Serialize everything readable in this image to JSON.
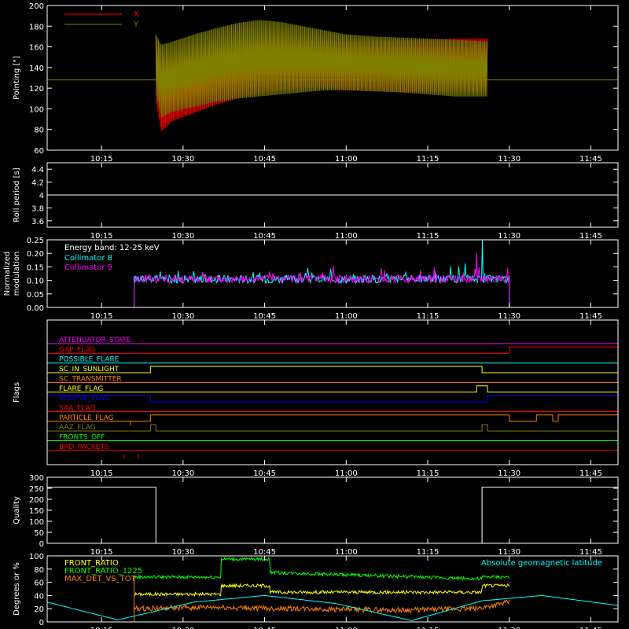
{
  "chart_data": [
    {
      "type": "line",
      "panel": "pointing",
      "ylabel": "Pointing [\"]",
      "ylim": [
        60,
        200
      ],
      "yticks": [
        60,
        80,
        100,
        120,
        140,
        160,
        180,
        200
      ],
      "xlim": [
        "10:05",
        "11:50"
      ],
      "xticks": [
        "10:15",
        "10:30",
        "10:45",
        "11:00",
        "11:15",
        "11:30",
        "11:45"
      ],
      "baseline": 128,
      "data_start": "10:25",
      "data_end": "11:26",
      "series": [
        {
          "name": "X",
          "color": "#ff0000",
          "time": [
            "10:25",
            "10:26",
            "10:28",
            "10:32",
            "10:36",
            "10:40",
            "10:44",
            "10:48",
            "10:52",
            "10:56",
            "11:00",
            "11:05",
            "11:10",
            "11:15",
            "11:20",
            "11:26"
          ],
          "upper": [
            170,
            155,
            150,
            152,
            158,
            162,
            165,
            167,
            166,
            165,
            165,
            166,
            166,
            167,
            168,
            168
          ],
          "lower": [
            108,
            78,
            88,
            96,
            104,
            110,
            115,
            118,
            120,
            120,
            118,
            117,
            116,
            116,
            116,
            116
          ]
        },
        {
          "name": "Y",
          "color": "#808000",
          "time": [
            "10:25",
            "10:26",
            "10:28",
            "10:32",
            "10:36",
            "10:40",
            "10:44",
            "10:48",
            "10:52",
            "10:56",
            "11:00",
            "11:05",
            "11:10",
            "11:15",
            "11:20",
            "11:26"
          ],
          "upper": [
            172,
            162,
            165,
            172,
            178,
            183,
            186,
            184,
            180,
            176,
            172,
            170,
            169,
            168,
            167,
            165
          ],
          "lower": [
            115,
            92,
            97,
            102,
            107,
            110,
            112,
            114,
            116,
            118,
            118,
            117,
            116,
            114,
            112,
            112
          ]
        }
      ]
    },
    {
      "type": "line",
      "panel": "roll-period",
      "ylabel": "Roll period [s]",
      "ylim": [
        3.5,
        4.5
      ],
      "yticks": [
        3.6,
        3.8,
        4.0,
        4.2,
        4.4
      ],
      "xticks": [
        "10:15",
        "10:30",
        "10:45",
        "11:00",
        "11:15",
        "11:30",
        "11:45"
      ],
      "series": [
        {
          "color": "#ffffff",
          "time": [
            "10:05",
            "11:50"
          ],
          "values": [
            4.0,
            4.0
          ]
        }
      ]
    },
    {
      "type": "line",
      "panel": "modulation",
      "ylabel": "Normalized modulation",
      "ylim": [
        0,
        0.25
      ],
      "yticks": [
        0.0,
        0.05,
        0.1,
        0.15,
        0.2,
        0.25
      ],
      "ytick_labels": [
        "0.00",
        "0.05",
        "0.10",
        "0.15",
        "0.20",
        "0.25"
      ],
      "xticks": [
        "10:15",
        "10:30",
        "10:45",
        "11:00",
        "11:15",
        "11:30",
        "11:45"
      ],
      "annotation": "Energy band: 12-25 keV",
      "data_start": "10:21",
      "data_end": "11:30",
      "level": 0.1,
      "series": [
        {
          "name": "Collimator 8",
          "color": "#00ffff",
          "spike_time": "11:25",
          "spike_value": 0.25
        },
        {
          "name": "Collimator 9",
          "color": "#ff00ff",
          "spike_time": "11:24",
          "spike_value": 0.2
        }
      ]
    },
    {
      "type": "line",
      "panel": "flags",
      "ylabel": "Flags",
      "xticks": [
        "10:15",
        "10:30",
        "10:45",
        "11:00",
        "11:15",
        "11:30",
        "11:45"
      ],
      "series": [
        {
          "name": "ATTENUATOR_STATE",
          "color": "#ff00ff",
          "segments": []
        },
        {
          "name": "GAP_FLAG",
          "color": "#ff0000",
          "segments": [
            [
              "11:30",
              "11:50"
            ]
          ]
        },
        {
          "name": "POSSIBLE_FLARE",
          "color": "#00ffff",
          "segments": []
        },
        {
          "name": "SC_IN_SUNLIGHT",
          "color": "#ffff00",
          "segments": [
            [
              "10:24",
              "11:25"
            ]
          ]
        },
        {
          "name": "SC_TRANSMITTER",
          "color": "#ff8000",
          "segments": []
        },
        {
          "name": "FLARE_FLAG",
          "color": "#ffff00",
          "segments": [
            [
              "11:24",
              "11:26"
            ]
          ]
        },
        {
          "name": "ECLIPSE_FLAG",
          "color": "#0000ff",
          "segments": [
            [
              "10:05",
              "10:24"
            ],
            [
              "11:26",
              "11:50"
            ]
          ]
        },
        {
          "name": "SAA_FLAG",
          "color": "#ff0000",
          "segments": []
        },
        {
          "name": "PARTICLE_FLAG",
          "color": "#ff8000",
          "segments": [
            [
              "10:24",
              "11:30"
            ],
            [
              "11:35",
              "11:38"
            ],
            [
              "11:39",
              "11:50"
            ]
          ]
        },
        {
          "name": "AAZ_FLAG",
          "color": "#808000",
          "segments": [
            [
              "10:24",
              "10:25"
            ],
            [
              "11:25",
              "11:26"
            ]
          ]
        },
        {
          "name": "FRONTS_OFF",
          "color": "#00ff00",
          "segments": []
        },
        {
          "name": "BAD_PACKETS",
          "color": "#ff0000",
          "segments": []
        }
      ]
    },
    {
      "type": "line",
      "panel": "quality",
      "ylabel": "Quality",
      "ylim": [
        0,
        300
      ],
      "yticks": [
        0,
        50,
        100,
        150,
        200,
        250,
        300
      ],
      "xticks": [
        "10:15",
        "10:30",
        "10:45",
        "11:00",
        "11:15",
        "11:30",
        "11:45"
      ],
      "series": [
        {
          "color": "#ffffff",
          "time": [
            "10:05",
            "10:25",
            "10:25",
            "11:25",
            "11:25",
            "11:30",
            "11:30",
            "11:50"
          ],
          "values": [
            255,
            255,
            0,
            0,
            255,
            255,
            255,
            255
          ]
        }
      ]
    },
    {
      "type": "line",
      "panel": "ratios",
      "ylabel": "Degrees or %",
      "ylim": [
        0,
        100
      ],
      "yticks": [
        0,
        20,
        40,
        60,
        80,
        100
      ],
      "xticks": [
        "10:15",
        "10:30",
        "10:45",
        "11:00",
        "11:15",
        "11:30",
        "11:45"
      ],
      "series": [
        {
          "name": "FRONT_RATIO",
          "color": "#ffff00",
          "time": [
            "10:21",
            "10:37",
            "10:37",
            "10:46",
            "10:46",
            "11:25",
            "11:25",
            "11:30"
          ],
          "values": [
            42,
            42,
            55,
            55,
            45,
            45,
            55,
            55
          ]
        },
        {
          "name": "FRONT_RATIO_1225",
          "color": "#00ff00",
          "time": [
            "10:21",
            "10:37",
            "10:37",
            "10:46",
            "10:46",
            "11:25",
            "11:25",
            "11:30"
          ],
          "values": [
            68,
            68,
            95,
            95,
            75,
            65,
            68,
            68
          ]
        },
        {
          "name": "MAX_DET_VS_TOT",
          "color": "#ff8000",
          "time": [
            "10:21",
            "10:35",
            "10:50",
            "11:10",
            "11:24",
            "11:30"
          ],
          "values": [
            20,
            22,
            20,
            18,
            20,
            30
          ]
        },
        {
          "name": "Absolute geomagnetic latitude",
          "color": "#00ffff",
          "time": [
            "10:05",
            "10:18",
            "10:32",
            "10:45",
            "10:58",
            "11:12",
            "11:25",
            "11:36",
            "11:50"
          ],
          "values": [
            30,
            3,
            30,
            40,
            28,
            2,
            32,
            40,
            25
          ]
        }
      ]
    }
  ]
}
